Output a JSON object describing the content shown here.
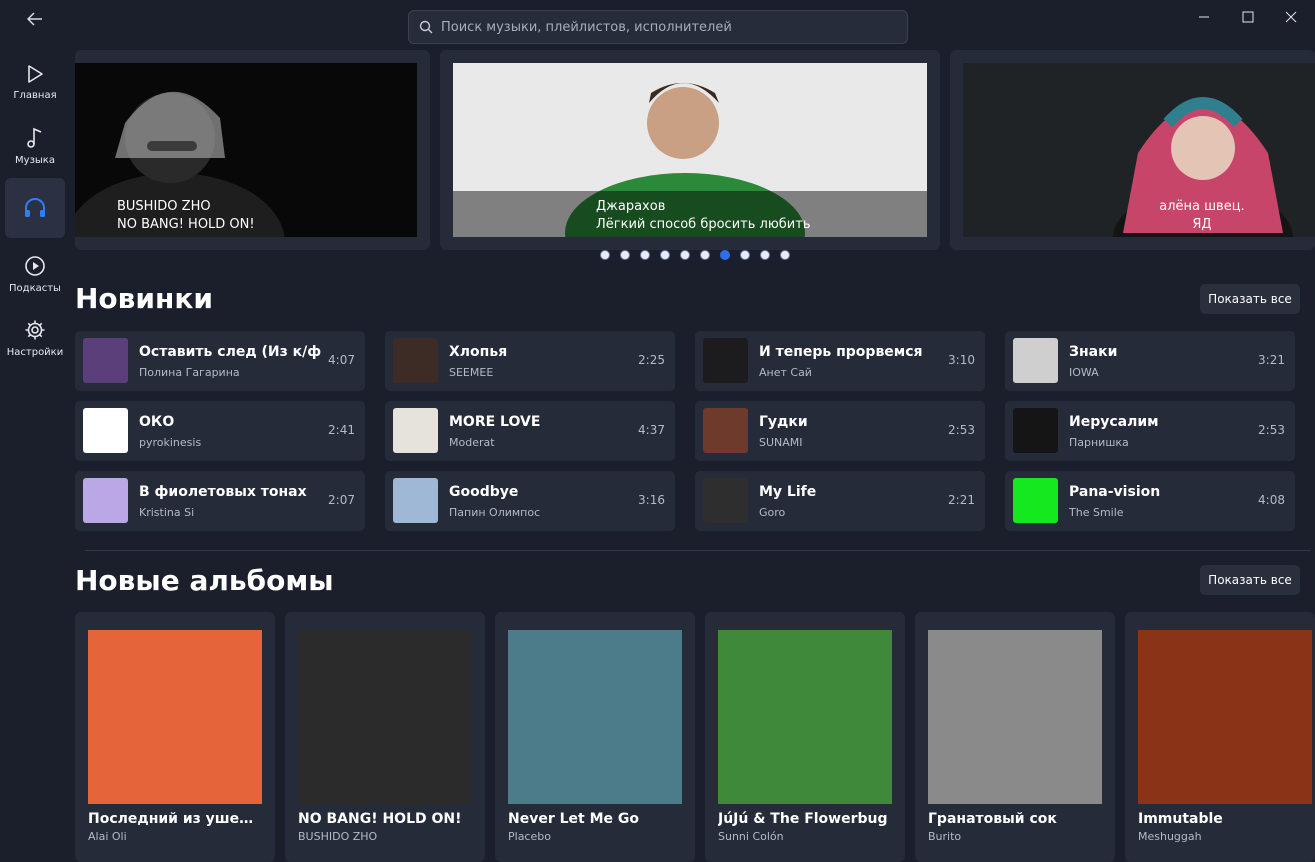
{
  "search": {
    "placeholder": "Поиск музыки, плейлистов, исполнителей"
  },
  "sidebar": {
    "items": [
      {
        "label": "Главная",
        "icon": "play-outline-icon"
      },
      {
        "label": "Музыка",
        "icon": "music-note-icon"
      },
      {
        "label": "",
        "icon": "headphones-icon",
        "active": true
      },
      {
        "label": "Подкасты",
        "icon": "play-circle-icon"
      },
      {
        "label": "Настройки",
        "icon": "gear-icon"
      }
    ]
  },
  "banners": [
    {
      "artist": "BUSHIDO ZHO",
      "title": "NO BANG! HOLD ON!"
    },
    {
      "artist": "Джарахов",
      "title": "Лёгкий способ бросить любить"
    },
    {
      "artist": "алёна швец.",
      "title": "ЯД"
    }
  ],
  "carousel": {
    "count": 10,
    "active_index": 6
  },
  "new_tracks": {
    "title": "Новинки",
    "show_all": "Показать все",
    "items": [
      {
        "title": "Оставить след (Из к/ф \"С",
        "artist": "Полина Гагарина",
        "duration": "4:07",
        "cover_color": "#5b3f7a"
      },
      {
        "title": "Хлопья",
        "artist": "SEEMEE",
        "duration": "2:25",
        "cover_color": "#3d2b26"
      },
      {
        "title": "И теперь прорвемся",
        "artist": "Анет Сай",
        "duration": "3:10",
        "cover_color": "#1c1c1f"
      },
      {
        "title": "Знаки",
        "artist": "IOWA",
        "duration": "3:21",
        "cover_color": "#cfcfcf"
      },
      {
        "title": "ОКО",
        "artist": "pyrokinesis",
        "duration": "2:41",
        "cover_color": "#ffffff"
      },
      {
        "title": "MORE LOVE",
        "artist": "Moderat",
        "duration": "4:37",
        "cover_color": "#e6e3dc"
      },
      {
        "title": "Гудки",
        "artist": "SUNAMI",
        "duration": "2:53",
        "cover_color": "#6d3a2c"
      },
      {
        "title": "Иерусалим",
        "artist": "Парнишка",
        "duration": "2:53",
        "cover_color": "#151515"
      },
      {
        "title": "В фиолетовых тонах",
        "artist": "Kristina Si",
        "duration": "2:07",
        "cover_color": "#b9a7e6"
      },
      {
        "title": "Goodbye",
        "artist": "Папин Олимпос",
        "duration": "3:16",
        "cover_color": "#9fb8d6"
      },
      {
        "title": "My Life",
        "artist": "Goro",
        "duration": "2:21",
        "cover_color": "#2e2e2e"
      },
      {
        "title": "Pana-vision",
        "artist": "The Smile",
        "duration": "4:08",
        "cover_color": "#15e81f"
      }
    ]
  },
  "new_albums": {
    "title": "Новые альбомы",
    "show_all": "Показать все",
    "items": [
      {
        "title": "Последний из ушед...",
        "artist": "Alai Oli",
        "cover_color": "#e6643a"
      },
      {
        "title": "NO BANG! HOLD ON!",
        "artist": "BUSHIDO ZHO",
        "cover_color": "#2b2b2b"
      },
      {
        "title": "Never Let Me Go",
        "artist": "Placebo",
        "cover_color": "#4c7b8a"
      },
      {
        "title": "JúJú & The Flowerbug",
        "artist": "Sunni Colón",
        "cover_color": "#3f8a3a"
      },
      {
        "title": "Гранатовый сок",
        "artist": "Burito",
        "cover_color": "#8a8a8a"
      },
      {
        "title": "Immutable",
        "artist": "Meshuggah",
        "cover_color": "#8b3316"
      }
    ]
  },
  "colors": {
    "accent": "#2f7ef5",
    "background": "#1b1f2b",
    "card": "#262b39"
  }
}
